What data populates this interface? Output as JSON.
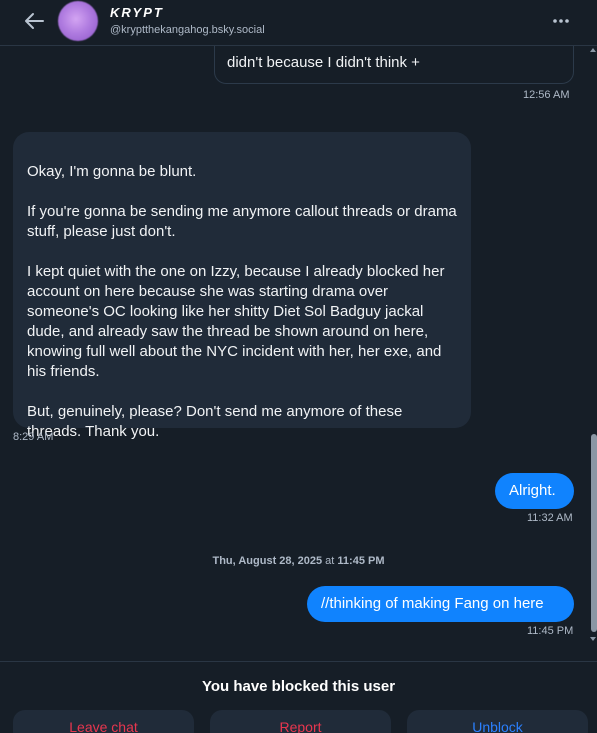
{
  "header": {
    "display_name": "KRYPT",
    "handle": "@kryptthekangahog.bsky.social"
  },
  "messages": {
    "partial_prev_line": "...",
    "partial_out_text": "didn't because I didn't think +",
    "partial_out_time": "12:56 AM",
    "incoming_text": "Okay, I'm gonna be blunt.\n\nIf you're gonna be sending me anymore callout threads or drama stuff, please just don't.\n\nI kept quiet with the one on Izzy, because I already blocked her account on here because she was starting drama over someone's OC looking like her shitty Diet Sol Badguy jackal dude, and already saw the thread be shown around on here, knowing full well about the NYC incident with her, her exe, and his friends.\n\nBut, genuinely, please? Don't send me anymore of these threads. Thank you.",
    "incoming_time": "8:29 AM",
    "out1_text": "Alright.",
    "out1_time": "11:32 AM",
    "date_sep_date": "Thu, August 28, 2025",
    "date_sep_at": " at ",
    "date_sep_time": "11:45 PM",
    "out2_text": "//thinking of making Fang on here",
    "out2_time": "11:45 PM"
  },
  "footer": {
    "blocked_text": "You have blocked this user",
    "leave_label": "Leave chat",
    "report_label": "Report",
    "unblock_label": "Unblock"
  },
  "colors": {
    "background": "#161e27",
    "incoming_bubble": "#202b39",
    "outgoing_bubble": "#1083fe",
    "danger": "#e8364f",
    "link": "#2b80ff"
  },
  "icons": {
    "back": "arrow-left-icon",
    "more": "dots-horizontal-icon"
  }
}
